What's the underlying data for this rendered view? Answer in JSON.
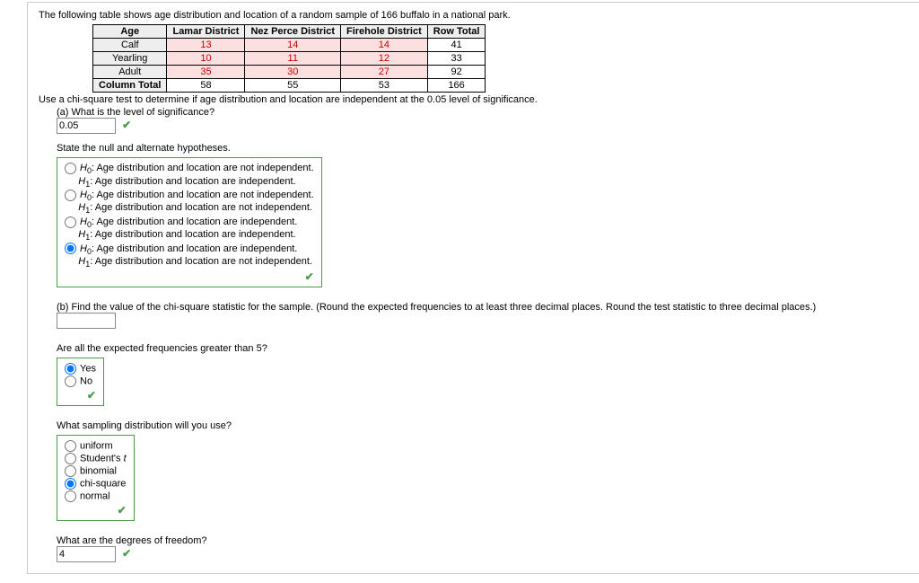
{
  "intro": "The following table shows age distribution and location of a random sample of 166 buffalo in a national park.",
  "table": {
    "headers": [
      "Age",
      "Lamar District",
      "Nez Perce District",
      "Firehole District",
      "Row Total"
    ],
    "rows": [
      {
        "label": "Calf",
        "cells": [
          "13",
          "14",
          "14"
        ],
        "total": "41"
      },
      {
        "label": "Yearling",
        "cells": [
          "10",
          "11",
          "12"
        ],
        "total": "33"
      },
      {
        "label": "Adult",
        "cells": [
          "35",
          "30",
          "27"
        ],
        "total": "92"
      }
    ],
    "foot": {
      "label": "Column Total",
      "cells": [
        "58",
        "55",
        "53"
      ],
      "total": "166"
    }
  },
  "chi_instr": "Use a chi-square test to determine if age distribution and location are independent at the 0.05 level of significance.",
  "qa": {
    "label": "(a) What is the level of significance?",
    "value": "0.05"
  },
  "hyp_label": "State the null and alternate hypotheses.",
  "hyp_opts": [
    {
      "h0": "Age distribution and location are not independent.",
      "h1": "Age distribution and location are independent."
    },
    {
      "h0": "Age distribution and location are not independent.",
      "h1": "Age distribution and location are not independent."
    },
    {
      "h0": "Age distribution and location are independent.",
      "h1": "Age distribution and location are independent."
    },
    {
      "h0": "Age distribution and location are independent.",
      "h1": "Age distribution and location are not independent."
    }
  ],
  "hyp_selected": 3,
  "qb": "(b) Find the value of the chi-square statistic for the sample. (Round the expected frequencies to at least three decimal places. Round the test statistic to three decimal places.)",
  "qb_val": "",
  "freq_q": "Are all the expected frequencies greater than 5?",
  "freq_opts": [
    "Yes",
    "No"
  ],
  "freq_selected": 0,
  "samp_q": "What sampling distribution will you use?",
  "samp_opts": [
    "uniform",
    "Student's t",
    "binomial",
    "chi-square",
    "normal"
  ],
  "samp_selected": 3,
  "df_q": "What are the degrees of freedom?",
  "df_val": "4"
}
